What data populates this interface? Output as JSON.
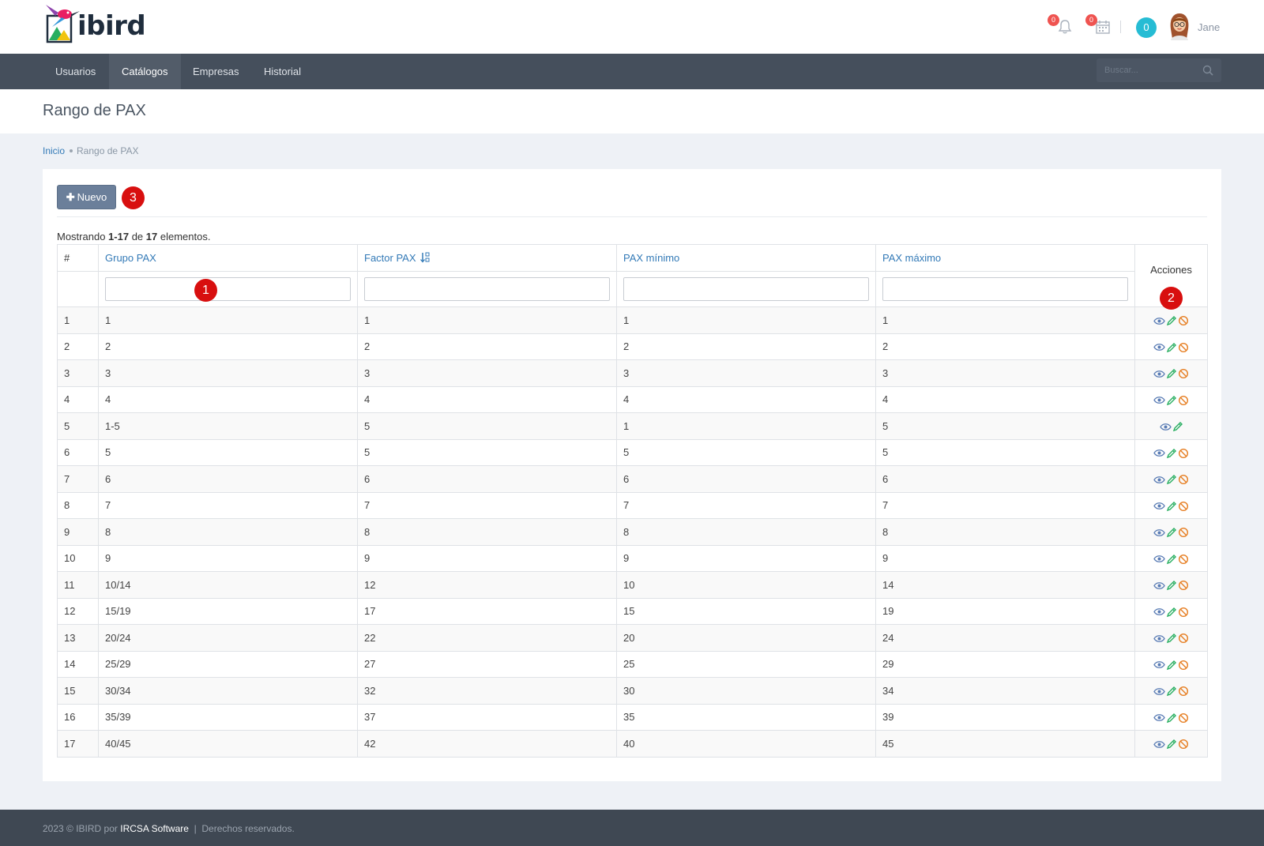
{
  "app": {
    "name": "ibird",
    "user": "Jane",
    "badge_count": "0",
    "notif_count": "0",
    "calendar_count": "0"
  },
  "nav": {
    "items": [
      {
        "label": "Usuarios"
      },
      {
        "label": "Catálogos"
      },
      {
        "label": "Empresas"
      },
      {
        "label": "Historial"
      }
    ],
    "search_placeholder": "Buscar..."
  },
  "page": {
    "title": "Rango de PAX"
  },
  "breadcrumb": {
    "home": "Inicio",
    "current": "Rango de PAX"
  },
  "toolbar": {
    "new_label": "Nuevo"
  },
  "summary": {
    "prefix": "Mostrando ",
    "range": "1-17",
    "mid": " de ",
    "total": "17",
    "suffix": " elementos."
  },
  "markers": [
    "1",
    "2",
    "3"
  ],
  "table": {
    "headers": {
      "num": "#",
      "grupo": "Grupo PAX",
      "factor": "Factor PAX",
      "min": "PAX mínimo",
      "max": "PAX máximo",
      "actions": "Acciones"
    },
    "rows": [
      {
        "num": "1",
        "grupo": "1",
        "factor": "1",
        "min": "1",
        "max": "1",
        "can_disable": true
      },
      {
        "num": "2",
        "grupo": "2",
        "factor": "2",
        "min": "2",
        "max": "2",
        "can_disable": true
      },
      {
        "num": "3",
        "grupo": "3",
        "factor": "3",
        "min": "3",
        "max": "3",
        "can_disable": true
      },
      {
        "num": "4",
        "grupo": "4",
        "factor": "4",
        "min": "4",
        "max": "4",
        "can_disable": true
      },
      {
        "num": "5",
        "grupo": "1-5",
        "factor": "5",
        "min": "1",
        "max": "5",
        "can_disable": false
      },
      {
        "num": "6",
        "grupo": "5",
        "factor": "5",
        "min": "5",
        "max": "5",
        "can_disable": true
      },
      {
        "num": "7",
        "grupo": "6",
        "factor": "6",
        "min": "6",
        "max": "6",
        "can_disable": true
      },
      {
        "num": "8",
        "grupo": "7",
        "factor": "7",
        "min": "7",
        "max": "7",
        "can_disable": true
      },
      {
        "num": "9",
        "grupo": "8",
        "factor": "8",
        "min": "8",
        "max": "8",
        "can_disable": true
      },
      {
        "num": "10",
        "grupo": "9",
        "factor": "9",
        "min": "9",
        "max": "9",
        "can_disable": true
      },
      {
        "num": "11",
        "grupo": "10/14",
        "factor": "12",
        "min": "10",
        "max": "14",
        "can_disable": true
      },
      {
        "num": "12",
        "grupo": "15/19",
        "factor": "17",
        "min": "15",
        "max": "19",
        "can_disable": true
      },
      {
        "num": "13",
        "grupo": "20/24",
        "factor": "22",
        "min": "20",
        "max": "24",
        "can_disable": true
      },
      {
        "num": "14",
        "grupo": "25/29",
        "factor": "27",
        "min": "25",
        "max": "29",
        "can_disable": true
      },
      {
        "num": "15",
        "grupo": "30/34",
        "factor": "32",
        "min": "30",
        "max": "34",
        "can_disable": true
      },
      {
        "num": "16",
        "grupo": "35/39",
        "factor": "37",
        "min": "35",
        "max": "39",
        "can_disable": true
      },
      {
        "num": "17",
        "grupo": "40/45",
        "factor": "42",
        "min": "40",
        "max": "45",
        "can_disable": true
      }
    ]
  },
  "icons": {
    "view": "eye-icon",
    "edit": "pencil-icon",
    "disable": "ban-icon",
    "search": "search-icon",
    "notifications": "bell-icon",
    "calendar": "calendar-icon",
    "sort": "sort-icon",
    "add": "plus-icon"
  },
  "colors": {
    "nav_bg": "#454f5c",
    "link": "#337ab7",
    "button": "#6b7f9a",
    "marker": "#d80f0f",
    "view_icon": "#5b7db5",
    "edit_icon": "#27ae60",
    "disable_icon": "#e67e22",
    "badge": "#26bcd4"
  },
  "footer": {
    "prefix": "2023 © IBIRD por ",
    "company": "IRCSA Software",
    "suffix": "  |  Derechos reservados."
  }
}
